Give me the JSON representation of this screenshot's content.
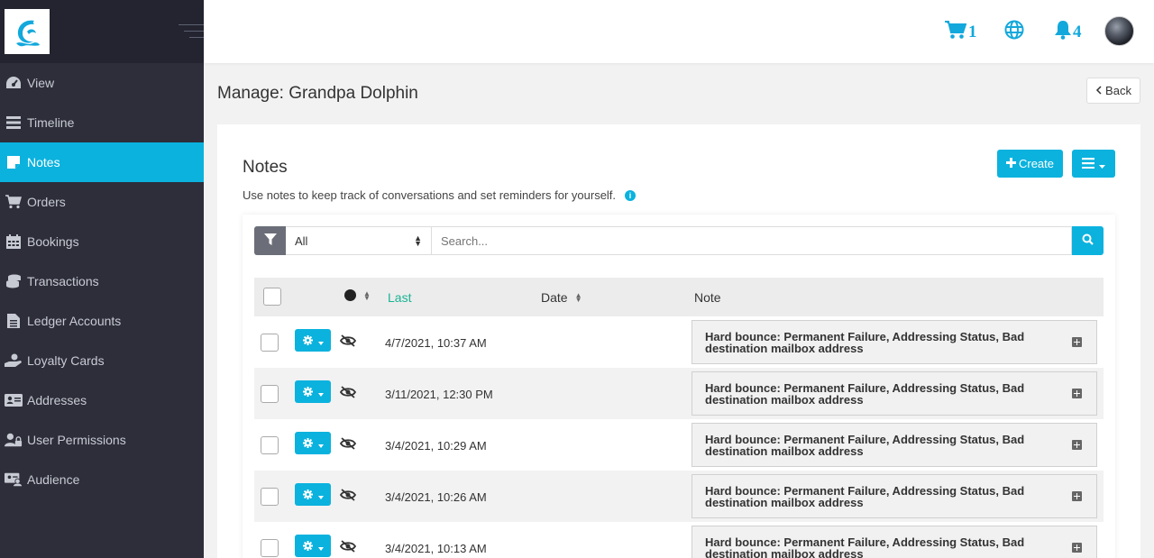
{
  "colors": {
    "accent": "#0bb2de",
    "sidebar_bg": "#2d2e3a",
    "sort_active": "#1ab394"
  },
  "sidebar": {
    "logo_icon": "dolphin-logo-icon",
    "items": [
      {
        "label": "View",
        "icon": "dashboard-icon"
      },
      {
        "label": "Timeline",
        "icon": "list-icon"
      },
      {
        "label": "Notes",
        "icon": "sticky-note-icon",
        "active": true
      },
      {
        "label": "Orders",
        "icon": "cart-icon"
      },
      {
        "label": "Bookings",
        "icon": "calendar-icon"
      },
      {
        "label": "Transactions",
        "icon": "coins-icon"
      },
      {
        "label": "Ledger Accounts",
        "icon": "ledger-icon"
      },
      {
        "label": "Loyalty Cards",
        "icon": "hand-holding-icon"
      },
      {
        "label": "Addresses",
        "icon": "address-card-icon"
      },
      {
        "label": "User Permissions",
        "icon": "user-lock-icon"
      },
      {
        "label": "Audience",
        "icon": "audience-icon"
      }
    ]
  },
  "topbar": {
    "cart_count": "1",
    "notification_count": "4"
  },
  "page": {
    "title": "Manage: Grandpa Dolphin",
    "back_label": "Back"
  },
  "notes": {
    "title": "Notes",
    "subtitle": "Use notes to keep track of conversations and set reminders for yourself.",
    "create_label": "Create",
    "filter": {
      "selected": "All",
      "search_placeholder": "Search..."
    },
    "columns": {
      "last": "Last",
      "date": "Date",
      "note": "Note"
    },
    "rows": [
      {
        "date": "4/7/2021, 10:37 AM",
        "note": "Hard bounce: Permanent Failure, Addressing Status, Bad destination mailbox address"
      },
      {
        "date": "3/11/2021, 12:30 PM",
        "note": "Hard bounce: Permanent Failure, Addressing Status, Bad destination mailbox address"
      },
      {
        "date": "3/4/2021, 10:29 AM",
        "note": "Hard bounce: Permanent Failure, Addressing Status, Bad destination mailbox address"
      },
      {
        "date": "3/4/2021, 10:26 AM",
        "note": "Hard bounce: Permanent Failure, Addressing Status, Bad destination mailbox address"
      },
      {
        "date": "3/4/2021, 10:13 AM",
        "note": "Hard bounce: Permanent Failure, Addressing Status, Bad destination mailbox address"
      }
    ]
  }
}
